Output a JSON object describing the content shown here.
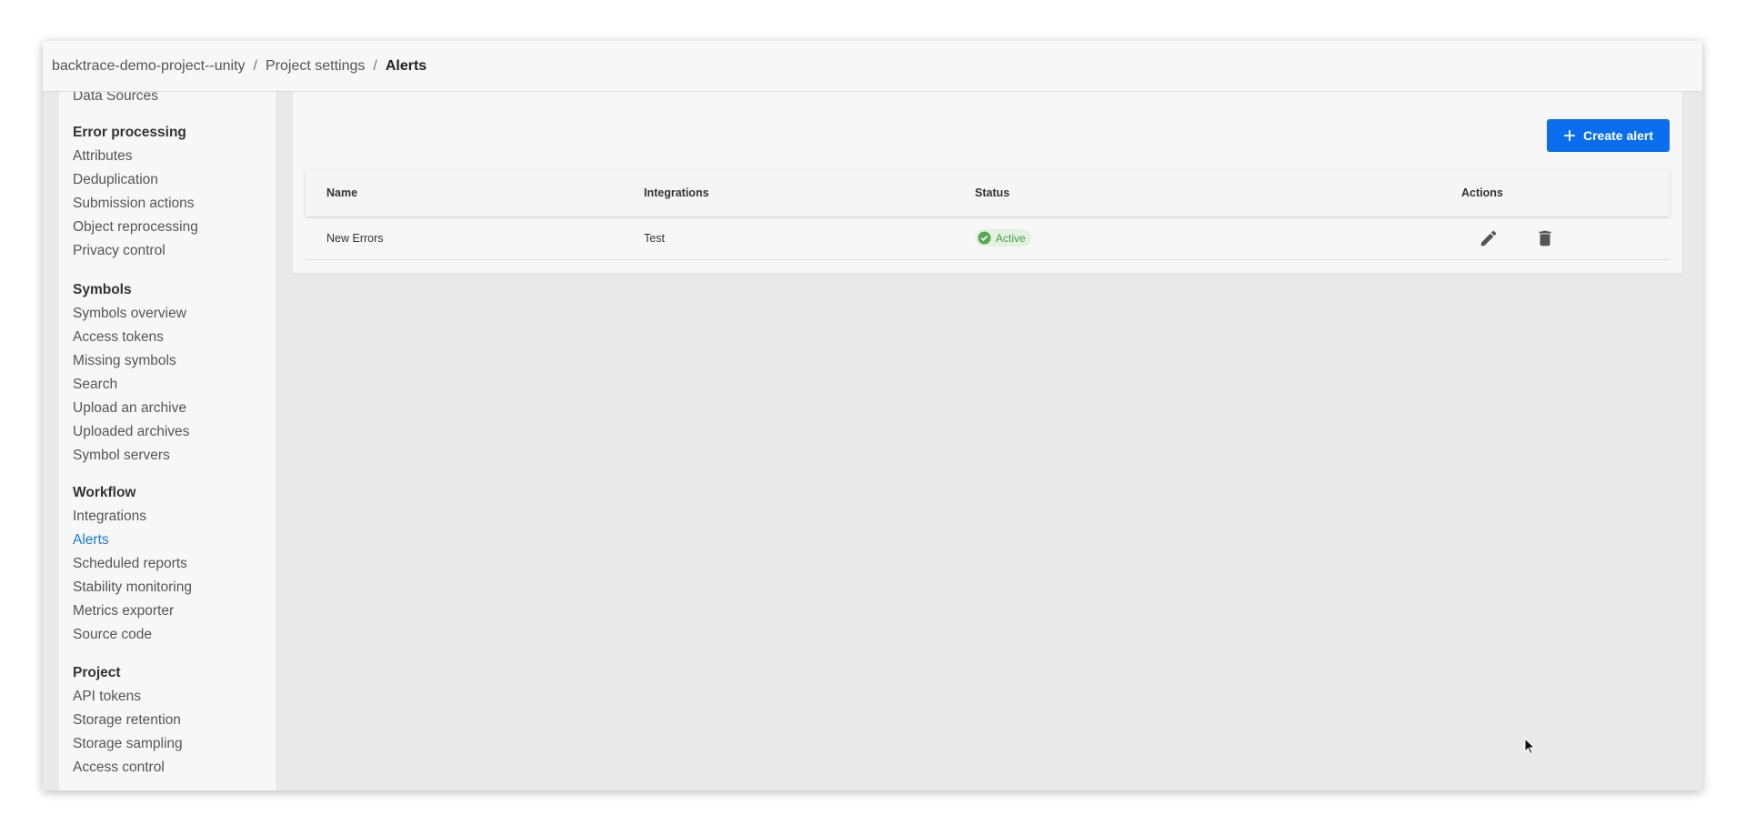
{
  "breadcrumb": {
    "project": "backtrace-demo-project--unity",
    "settings": "Project settings",
    "current": "Alerts",
    "separator": "/"
  },
  "sidebar": {
    "top_item": "Data Sources",
    "sections": [
      {
        "title": "Error processing",
        "items": [
          "Attributes",
          "Deduplication",
          "Submission actions",
          "Object reprocessing",
          "Privacy control"
        ]
      },
      {
        "title": "Symbols",
        "items": [
          "Symbols overview",
          "Access tokens",
          "Missing symbols",
          "Search",
          "Upload an archive",
          "Uploaded archives",
          "Symbol servers"
        ]
      },
      {
        "title": "Workflow",
        "items": [
          "Integrations",
          "Alerts",
          "Scheduled reports",
          "Stability monitoring",
          "Metrics exporter",
          "Source code"
        ]
      },
      {
        "title": "Project",
        "items": [
          "API tokens",
          "Storage retention",
          "Storage sampling",
          "Access control"
        ]
      }
    ],
    "active_item": "Alerts"
  },
  "toolbar": {
    "create_label": "Create alert"
  },
  "table": {
    "columns": [
      "Name",
      "Integrations",
      "Status",
      "Actions"
    ],
    "rows": [
      {
        "name": "New Errors",
        "integrations": "Test",
        "status": "Active"
      }
    ]
  },
  "icons": {
    "create": "plus-icon",
    "status": "check-circle-icon",
    "edit": "pencil-icon",
    "delete": "trash-icon"
  },
  "colors": {
    "primary": "#0a6ded",
    "active_link": "#1a7ad6",
    "status_green": "#4d9b45",
    "status_bg": "#e3f1e1"
  }
}
